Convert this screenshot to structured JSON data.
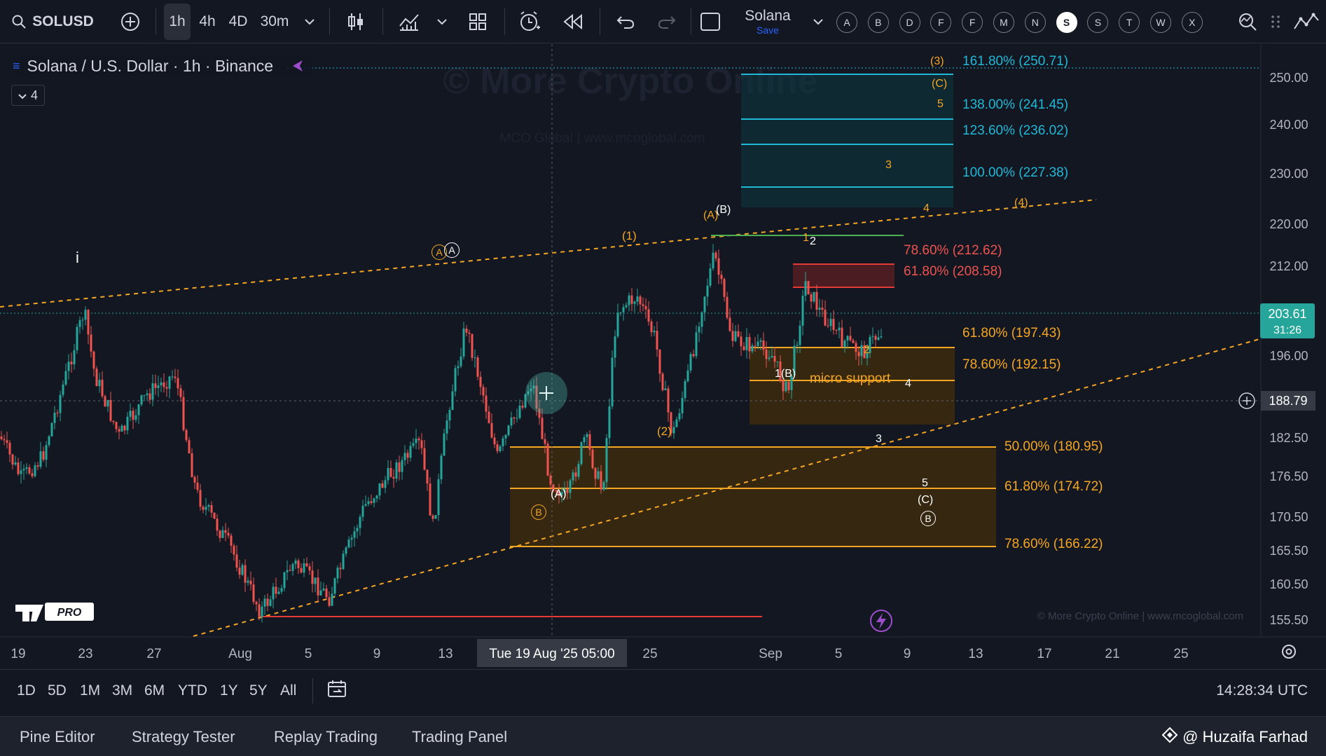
{
  "toolbar": {
    "symbol": "SOLUSD",
    "intervals": [
      "1h",
      "4h",
      "4D",
      "30m"
    ],
    "active_interval": "1h",
    "layout_name": "Solana",
    "layout_status": "Save",
    "watchlist_letters": [
      "A",
      "B",
      "D",
      "F",
      "F",
      "M",
      "N",
      "S",
      "S",
      "T",
      "W",
      "X"
    ],
    "selected_letter_index": 7
  },
  "chart": {
    "legend_title": "Solana / U.S. Dollar · 1h · Binance",
    "indicator_count": "4",
    "watermark": "© More Crypto Online",
    "watermark_sub": "MCO Global   |   www.mcoglobal.com",
    "attribution": "© More Crypto Online   |   www.mcoglobal.com",
    "tv_logo": "PRO",
    "price_axis": [
      "250.00",
      "240.00",
      "230.00",
      "220.00",
      "212.00",
      "196.00",
      "182.50",
      "176.50",
      "170.50",
      "165.50",
      "160.50",
      "155.50"
    ],
    "current_price": "203.61",
    "countdown": "31:26",
    "crosshair_price": "188.79",
    "time_axis": [
      "19",
      "23",
      "27",
      "Aug",
      "5",
      "9",
      "13",
      "25",
      "Sep",
      "5",
      "9",
      "13",
      "17",
      "21",
      "25"
    ],
    "crosshair_time": "Tue 19 Aug '25   05:00",
    "fib_levels_upper": [
      "161.80% (250.71)",
      "138.00% (241.45)",
      "123.60% (236.02)",
      "100.00% (227.38)"
    ],
    "fib_levels_red": [
      "78.60% (212.62)",
      "61.80% (208.58)"
    ],
    "fib_levels_mid": [
      "61.80% (197.43)",
      "78.60% (192.15)"
    ],
    "fib_levels_lower": [
      "50.00% (180.95)",
      "61.80% (174.72)",
      "78.60% (166.22)"
    ],
    "micro_support": "micro support",
    "wave_labels": {
      "i": "i",
      "A_circ": "A",
      "one_paren": "(1)",
      "two_paren": "(2)",
      "A_paren_low": "(A)",
      "B_circ_low": "B",
      "A_paren_top": "(A)",
      "B_paren_top": "(B)",
      "one_top": "1",
      "two_top": "2",
      "two_low": "2",
      "one_B": "1(B)",
      "four_low": "4",
      "three_low": "3",
      "five_low": "5",
      "C_paren_low": "(C)",
      "B_circ_right": "B",
      "three_paren": "(3)",
      "C_paren_top": "(C)",
      "five_top": "5",
      "three_top": "3",
      "four_right": "4",
      "four_paren": "(4)"
    },
    "colors": {
      "up": "#26a69a",
      "down": "#ef5350",
      "fib_orange": "#f5a623",
      "fib_cyan": "#21b7d6",
      "fib_red": "#e53935",
      "background": "#131722"
    }
  },
  "ranges": [
    "1D",
    "5D",
    "1M",
    "3M",
    "6M",
    "YTD",
    "1Y",
    "5Y",
    "All"
  ],
  "clock": "14:28:34 UTC",
  "panels": [
    "Pine Editor",
    "Strategy Tester",
    "Replay Trading",
    "Trading Panel"
  ],
  "credit": "@ Huzaifa Farhad"
}
